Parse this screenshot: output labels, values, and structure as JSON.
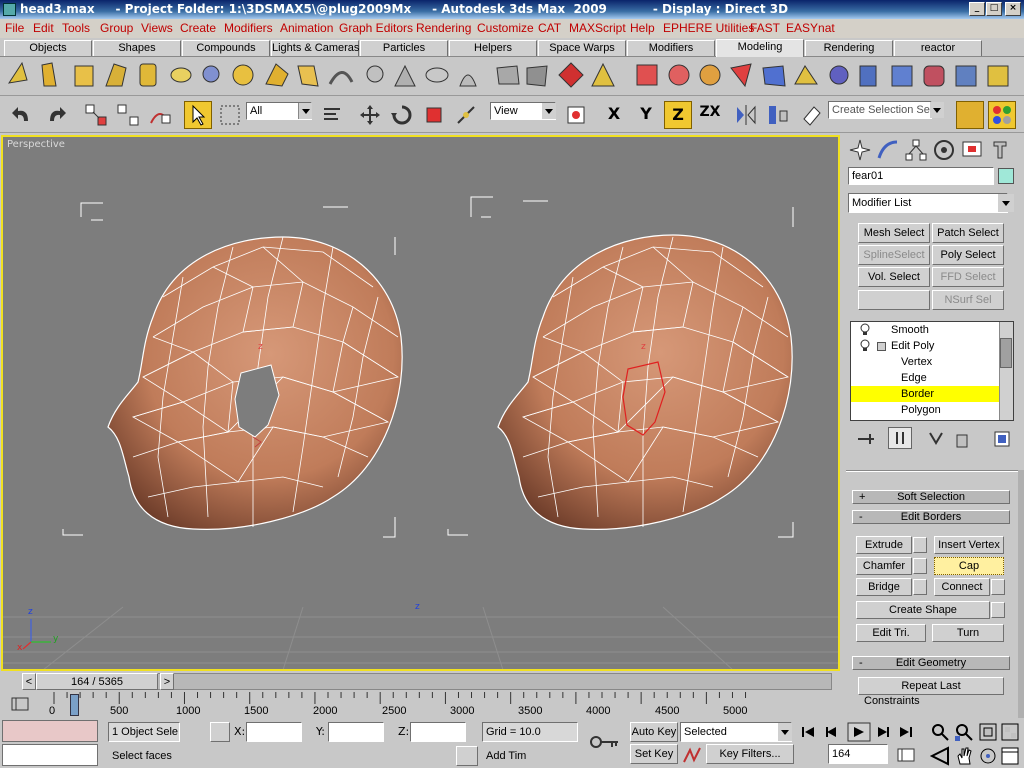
{
  "window": {
    "title": "head3.max     - Project Folder: 1:\\3DSMAX5\\@plug2009Mx     - Autodesk 3ds Max  2009           - Display : Direct 3D",
    "minimize": "_",
    "maximize": "□",
    "close": "×"
  },
  "menu": [
    "File",
    "Edit",
    "Tools",
    "Group",
    "Views",
    "Create",
    "Modifiers",
    "Animation",
    "Graph Editors",
    "Rendering",
    "Customize",
    "CAT",
    "MAXScript",
    "Help",
    "EPHERE Utilities",
    "FAST",
    "EASYnat"
  ],
  "tabs": [
    "Objects",
    "Shapes",
    "Compounds",
    "Lights & Cameras",
    "Particles",
    "Helpers",
    "Space Warps",
    "Modifiers",
    "Modeling",
    "Rendering",
    "reactor"
  ],
  "active_tab": "Modeling",
  "toolbar": {
    "selection_filter": "All",
    "reference_coord": "View",
    "named_selection": "Create Selection Set",
    "axis_x": "X",
    "axis_y": "Y",
    "axis_z": "Z",
    "axis_zx": "ZX"
  },
  "viewport": {
    "label": "Perspective",
    "axis_z": "z",
    "axis_y": "y",
    "axis_x": "x",
    "center_z": "z"
  },
  "command_panel": {
    "object_name": "fear01",
    "modifier_list": "Modifier List",
    "modifier_buttons": [
      {
        "label": "Mesh Select",
        "enabled": true
      },
      {
        "label": "Patch Select",
        "enabled": true
      },
      {
        "label": "SplineSelect",
        "enabled": false
      },
      {
        "label": "Poly Select",
        "enabled": true
      },
      {
        "label": "Vol. Select",
        "enabled": true
      },
      {
        "label": "FFD Select",
        "enabled": false
      },
      {
        "label": "",
        "enabled": false
      },
      {
        "label": "NSurf Sel",
        "enabled": false
      }
    ],
    "stack": [
      {
        "label": "Smooth",
        "level": 0,
        "selected": false
      },
      {
        "label": "Edit Poly",
        "level": 0,
        "selected": false
      },
      {
        "label": "Vertex",
        "level": 1,
        "selected": false
      },
      {
        "label": "Edge",
        "level": 1,
        "selected": false
      },
      {
        "label": "Border",
        "level": 1,
        "selected": true
      },
      {
        "label": "Polygon",
        "level": 1,
        "selected": false
      }
    ],
    "soft_selection": {
      "sign": "+",
      "title": "Soft Selection"
    },
    "edit_borders": {
      "sign": "-",
      "title": "Edit Borders",
      "extrude": "Extrude",
      "insert_vertex": "Insert Vertex",
      "chamfer": "Chamfer",
      "cap": "Cap",
      "bridge": "Bridge",
      "connect": "Connect",
      "create_shape": "Create Shape",
      "edit_tri": "Edit Tri.",
      "turn": "Turn"
    },
    "edit_geometry": {
      "sign": "-",
      "title": "Edit Geometry",
      "repeat_last": "Repeat Last",
      "constraints": "Constraints"
    }
  },
  "time_slider": {
    "label": "164 / 5365",
    "prev": "<",
    "next": ">",
    "current": 164,
    "total": 5365
  },
  "timeline": {
    "ticks": [
      "0",
      "500",
      "1000",
      "1500",
      "2000",
      "2500",
      "3000",
      "3500",
      "4000",
      "4500",
      "5000"
    ]
  },
  "status": {
    "object_count": "1 Object Sele",
    "x_label": "X:",
    "y_label": "Y:",
    "z_label": "Z:",
    "x": "",
    "y": "",
    "z": "",
    "grid": "Grid = 10.0",
    "prompt": "Select faces",
    "add_time_tag": "Add Tim",
    "auto_key": "Auto Key",
    "set_key": "Set Key",
    "key_mode": "Selected",
    "key_filters": "Key Filters...",
    "frame": "164"
  },
  "colors": {
    "viewport_bg": "#7d7d7d",
    "active_border": "#f0e020",
    "stack_selected": "#ffff00",
    "object_color": "#a0e8d8",
    "menu_text": "#c00000",
    "head_skin": "#c98a6a",
    "wire": "#ffffff"
  }
}
